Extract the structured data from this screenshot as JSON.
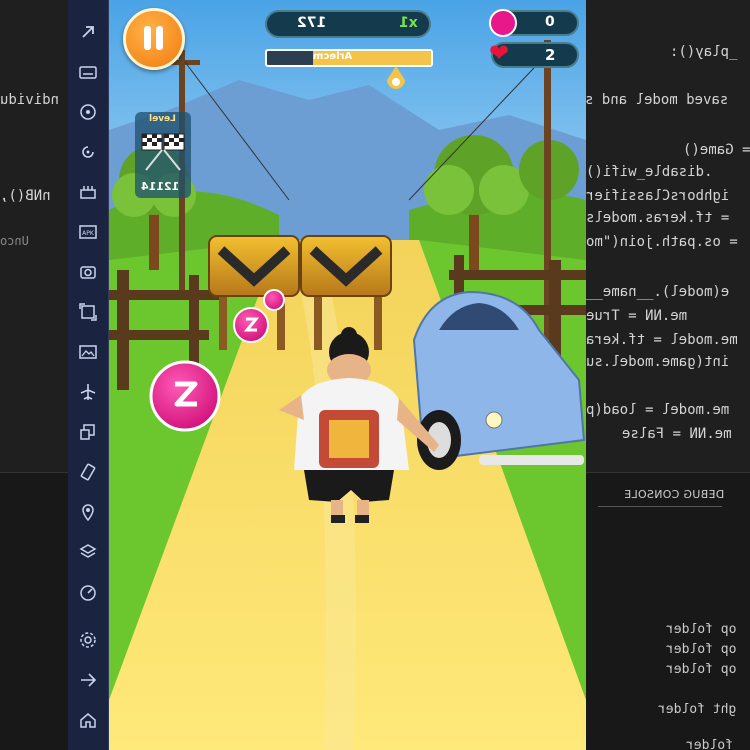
{
  "editor": {
    "code_lines": [
      "_play():",
      "saved model and s",
      "ndividu",
      "= Game()",
      ".disable_wifi()",
      "ighborsClassifier",
      "= tf.keras.models",
      "= os.path.join(\"mo",
      "nNB(),",
      "Unco",
      "e(model).__name__",
      "me.NN = True",
      "me.model = tf.kera",
      "int(game.model.su",
      "me.model = load(p",
      "me.NN = False"
    ],
    "panel_tab": "DEBUG CONSOLE",
    "terminal_lines": [
      "op folder",
      "op folder",
      "op folder",
      "ght folder",
      "folder"
    ]
  },
  "sidebar": {
    "buttons": [
      "pointer-icon",
      "keyboard-icon",
      "gamepad-icon",
      "rotate-icon",
      "macro-icon",
      "apk-icon",
      "screenshot-icon",
      "resize-icon",
      "media-icon",
      "airplane-icon",
      "multi-instance-icon",
      "shake-icon",
      "location-icon",
      "layers-icon",
      "performance-icon",
      "settings-icon",
      "back-icon",
      "home-icon"
    ]
  },
  "hud": {
    "score": "172",
    "multiplier": "x1",
    "player_name": "Arlecm",
    "energy": "0",
    "lives": "2",
    "level_label": "Level",
    "level_value": "12114",
    "progress_fraction": 0.72
  },
  "colors": {
    "pink_coin": "#e8178a",
    "barrier": "#d59a1c",
    "car": "#8fb6e8",
    "track": "#f4d64a",
    "grass": "#6cc72e"
  }
}
